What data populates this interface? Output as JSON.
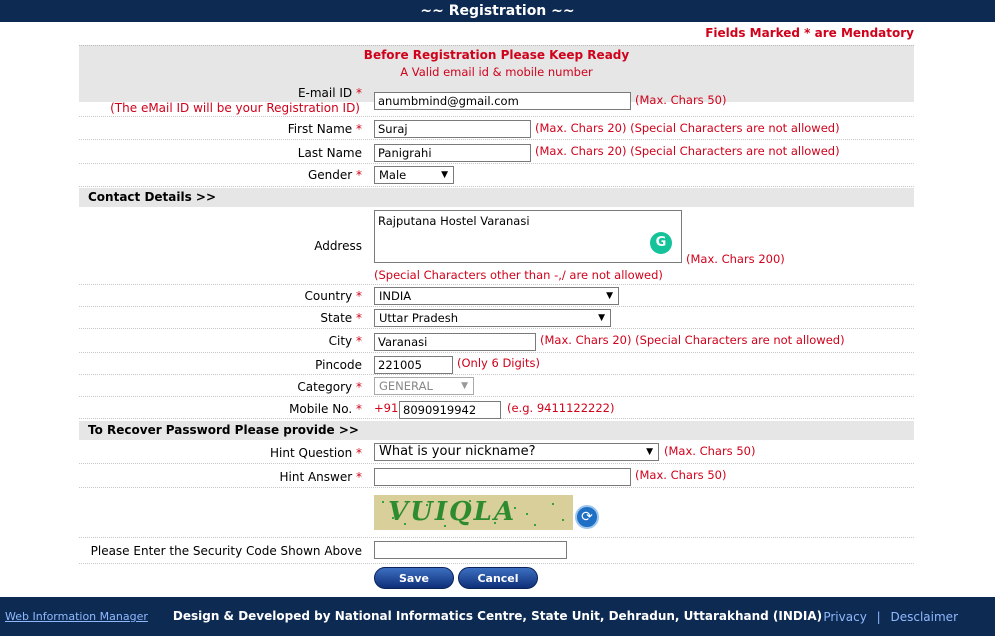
{
  "header": {
    "title": "~~ Registration ~~"
  },
  "notes": {
    "mandatory": "Fields Marked * are Mendatory"
  },
  "notice": {
    "title": "Before Registration Please Keep Ready",
    "subtitle": "A Valid email id & mobile number"
  },
  "form": {
    "email": {
      "label": "E-mail ID",
      "star": "*",
      "sublabel": "(The eMail ID will be your Registration ID)",
      "value": "anumbmind@gmail.com",
      "hint": "(Max. Chars 50)"
    },
    "first_name": {
      "label": "First Name",
      "star": "*",
      "value": "Suraj",
      "hint": "(Max. Chars 20) (Special Characters are not allowed)"
    },
    "last_name": {
      "label": "Last Name",
      "value": "Panigrahi",
      "hint": "(Max. Chars 20) (Special Characters are not allowed)"
    },
    "gender": {
      "label": "Gender",
      "star": "*",
      "value": "Male"
    }
  },
  "contact_section": {
    "title": "Contact Details  >>"
  },
  "contact": {
    "address": {
      "label": "Address",
      "value": "Rajputana Hostel Varanasi",
      "hint": "(Max. Chars 200)",
      "hint2": "(Special Characters other than -,/ are not allowed)"
    },
    "country": {
      "label": "Country",
      "star": "*",
      "value": "INDIA"
    },
    "state": {
      "label": "State",
      "star": "*",
      "value": "Uttar Pradesh"
    },
    "city": {
      "label": "City",
      "star": "*",
      "value": "Varanasi",
      "hint": "(Max. Chars 20) (Special Characters are not allowed)"
    },
    "pincode": {
      "label": "Pincode",
      "value": "221005",
      "hint": "(Only 6 Digits)"
    },
    "category": {
      "label": "Category",
      "star": "*",
      "value": "GENERAL"
    },
    "mobile": {
      "label": "Mobile No.",
      "star": "*",
      "prefix": "+91",
      "value": "8090919942",
      "hint": "(e.g. 9411122222)"
    }
  },
  "recover_section": {
    "title": "To Recover Password Please provide  >>"
  },
  "recover": {
    "hint_question": {
      "label": "Hint Question",
      "star": "*",
      "value": "What is your nickname?",
      "hint": "(Max. Chars 50)"
    },
    "hint_answer": {
      "label": "Hint Answer",
      "star": "*",
      "value": "",
      "hint": "(Max. Chars 50)"
    },
    "captcha": {
      "text": "VUIQLA"
    },
    "security_code": {
      "label": "Please Enter the Security Code Shown Above",
      "value": ""
    }
  },
  "buttons": {
    "save": "Save",
    "cancel": "Cancel"
  },
  "footer": {
    "left_link": "Web Information Manager",
    "credit": "Design & Developed by National Informatics Centre, State Unit, Dehradun, Uttarakhand (INDIA)",
    "privacy": "Privacy",
    "separator": "|",
    "disclaimer": "Desclaimer"
  },
  "icons": {
    "grammarly": "grammarly-icon",
    "refresh": "refresh-icon",
    "dropdown": "chevron-down-icon"
  },
  "colors": {
    "header_bg": "#0d2a52",
    "required": "#d0021b",
    "section_bg": "#e6e6e6",
    "captcha_text": "#2e8b2e"
  }
}
